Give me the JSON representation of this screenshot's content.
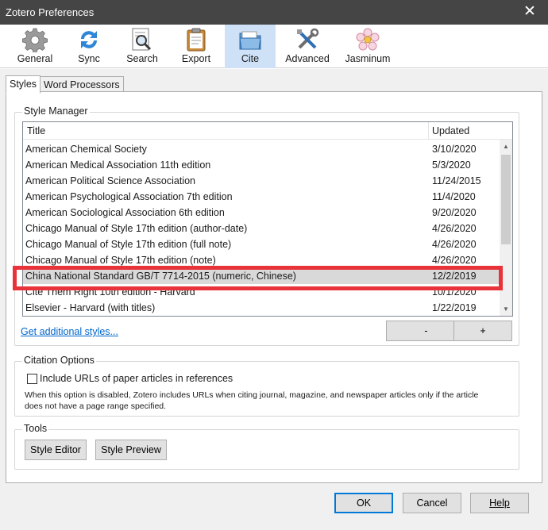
{
  "window": {
    "title": "Zotero Preferences",
    "close_glyph": "✕"
  },
  "toolbar": [
    {
      "label": "General",
      "icon": "gear-icon"
    },
    {
      "label": "Sync",
      "icon": "sync-icon"
    },
    {
      "label": "Search",
      "icon": "search-icon"
    },
    {
      "label": "Export",
      "icon": "clipboard-icon"
    },
    {
      "label": "Cite",
      "icon": "folder-icon",
      "selected": true
    },
    {
      "label": "Advanced",
      "icon": "tools-icon"
    },
    {
      "label": "Jasminum",
      "icon": "flower-icon"
    }
  ],
  "tabs": [
    {
      "label": "Styles",
      "active": true
    },
    {
      "label": "Word Processors",
      "active": false
    }
  ],
  "style_manager": {
    "caption": "Style Manager",
    "columns": {
      "title": "Title",
      "updated": "Updated"
    },
    "rows": [
      {
        "title": "American Chemical Society",
        "updated": "3/10/2020"
      },
      {
        "title": "American Medical Association 11th edition",
        "updated": "5/3/2020"
      },
      {
        "title": "American Political Science Association",
        "updated": "11/24/2015"
      },
      {
        "title": "American Psychological Association 7th edition",
        "updated": "11/4/2020"
      },
      {
        "title": "American Sociological Association 6th edition",
        "updated": "9/20/2020"
      },
      {
        "title": "Chicago Manual of Style 17th edition (author-date)",
        "updated": "4/26/2020"
      },
      {
        "title": "Chicago Manual of Style 17th edition (full note)",
        "updated": "4/26/2020"
      },
      {
        "title": "Chicago Manual of Style 17th edition (note)",
        "updated": "4/26/2020"
      },
      {
        "title": "China National Standard GB/T 7714-2015 (numeric, Chinese)",
        "updated": "12/2/2019",
        "selected": true
      },
      {
        "title": "Cite Them Right 10th edition - Harvard",
        "updated": "10/1/2020"
      },
      {
        "title": "Elsevier - Harvard (with titles)",
        "updated": "1/22/2019"
      }
    ],
    "get_more_link": "Get additional styles...",
    "remove_label": "-",
    "add_label": "+"
  },
  "citation_options": {
    "caption": "Citation Options",
    "include_urls_label": "Include URLs of paper articles in references",
    "include_urls_checked": false,
    "note_line1": "When this option is disabled, Zotero includes URLs when citing journal, magazine, and newspaper articles only if the article",
    "note_line2": "does not have a page range specified."
  },
  "tools": {
    "caption": "Tools",
    "style_editor_label": "Style Editor",
    "style_preview_label": "Style Preview"
  },
  "dialog_buttons": {
    "ok": "OK",
    "cancel": "Cancel",
    "help": "Help"
  },
  "colors": {
    "titlebar_bg": "#454545",
    "selected_toolbar_bg": "#cfe1f7",
    "highlight_border": "#e8333a",
    "link": "#0066cc",
    "selected_row_bg": "#d9d9d9"
  }
}
